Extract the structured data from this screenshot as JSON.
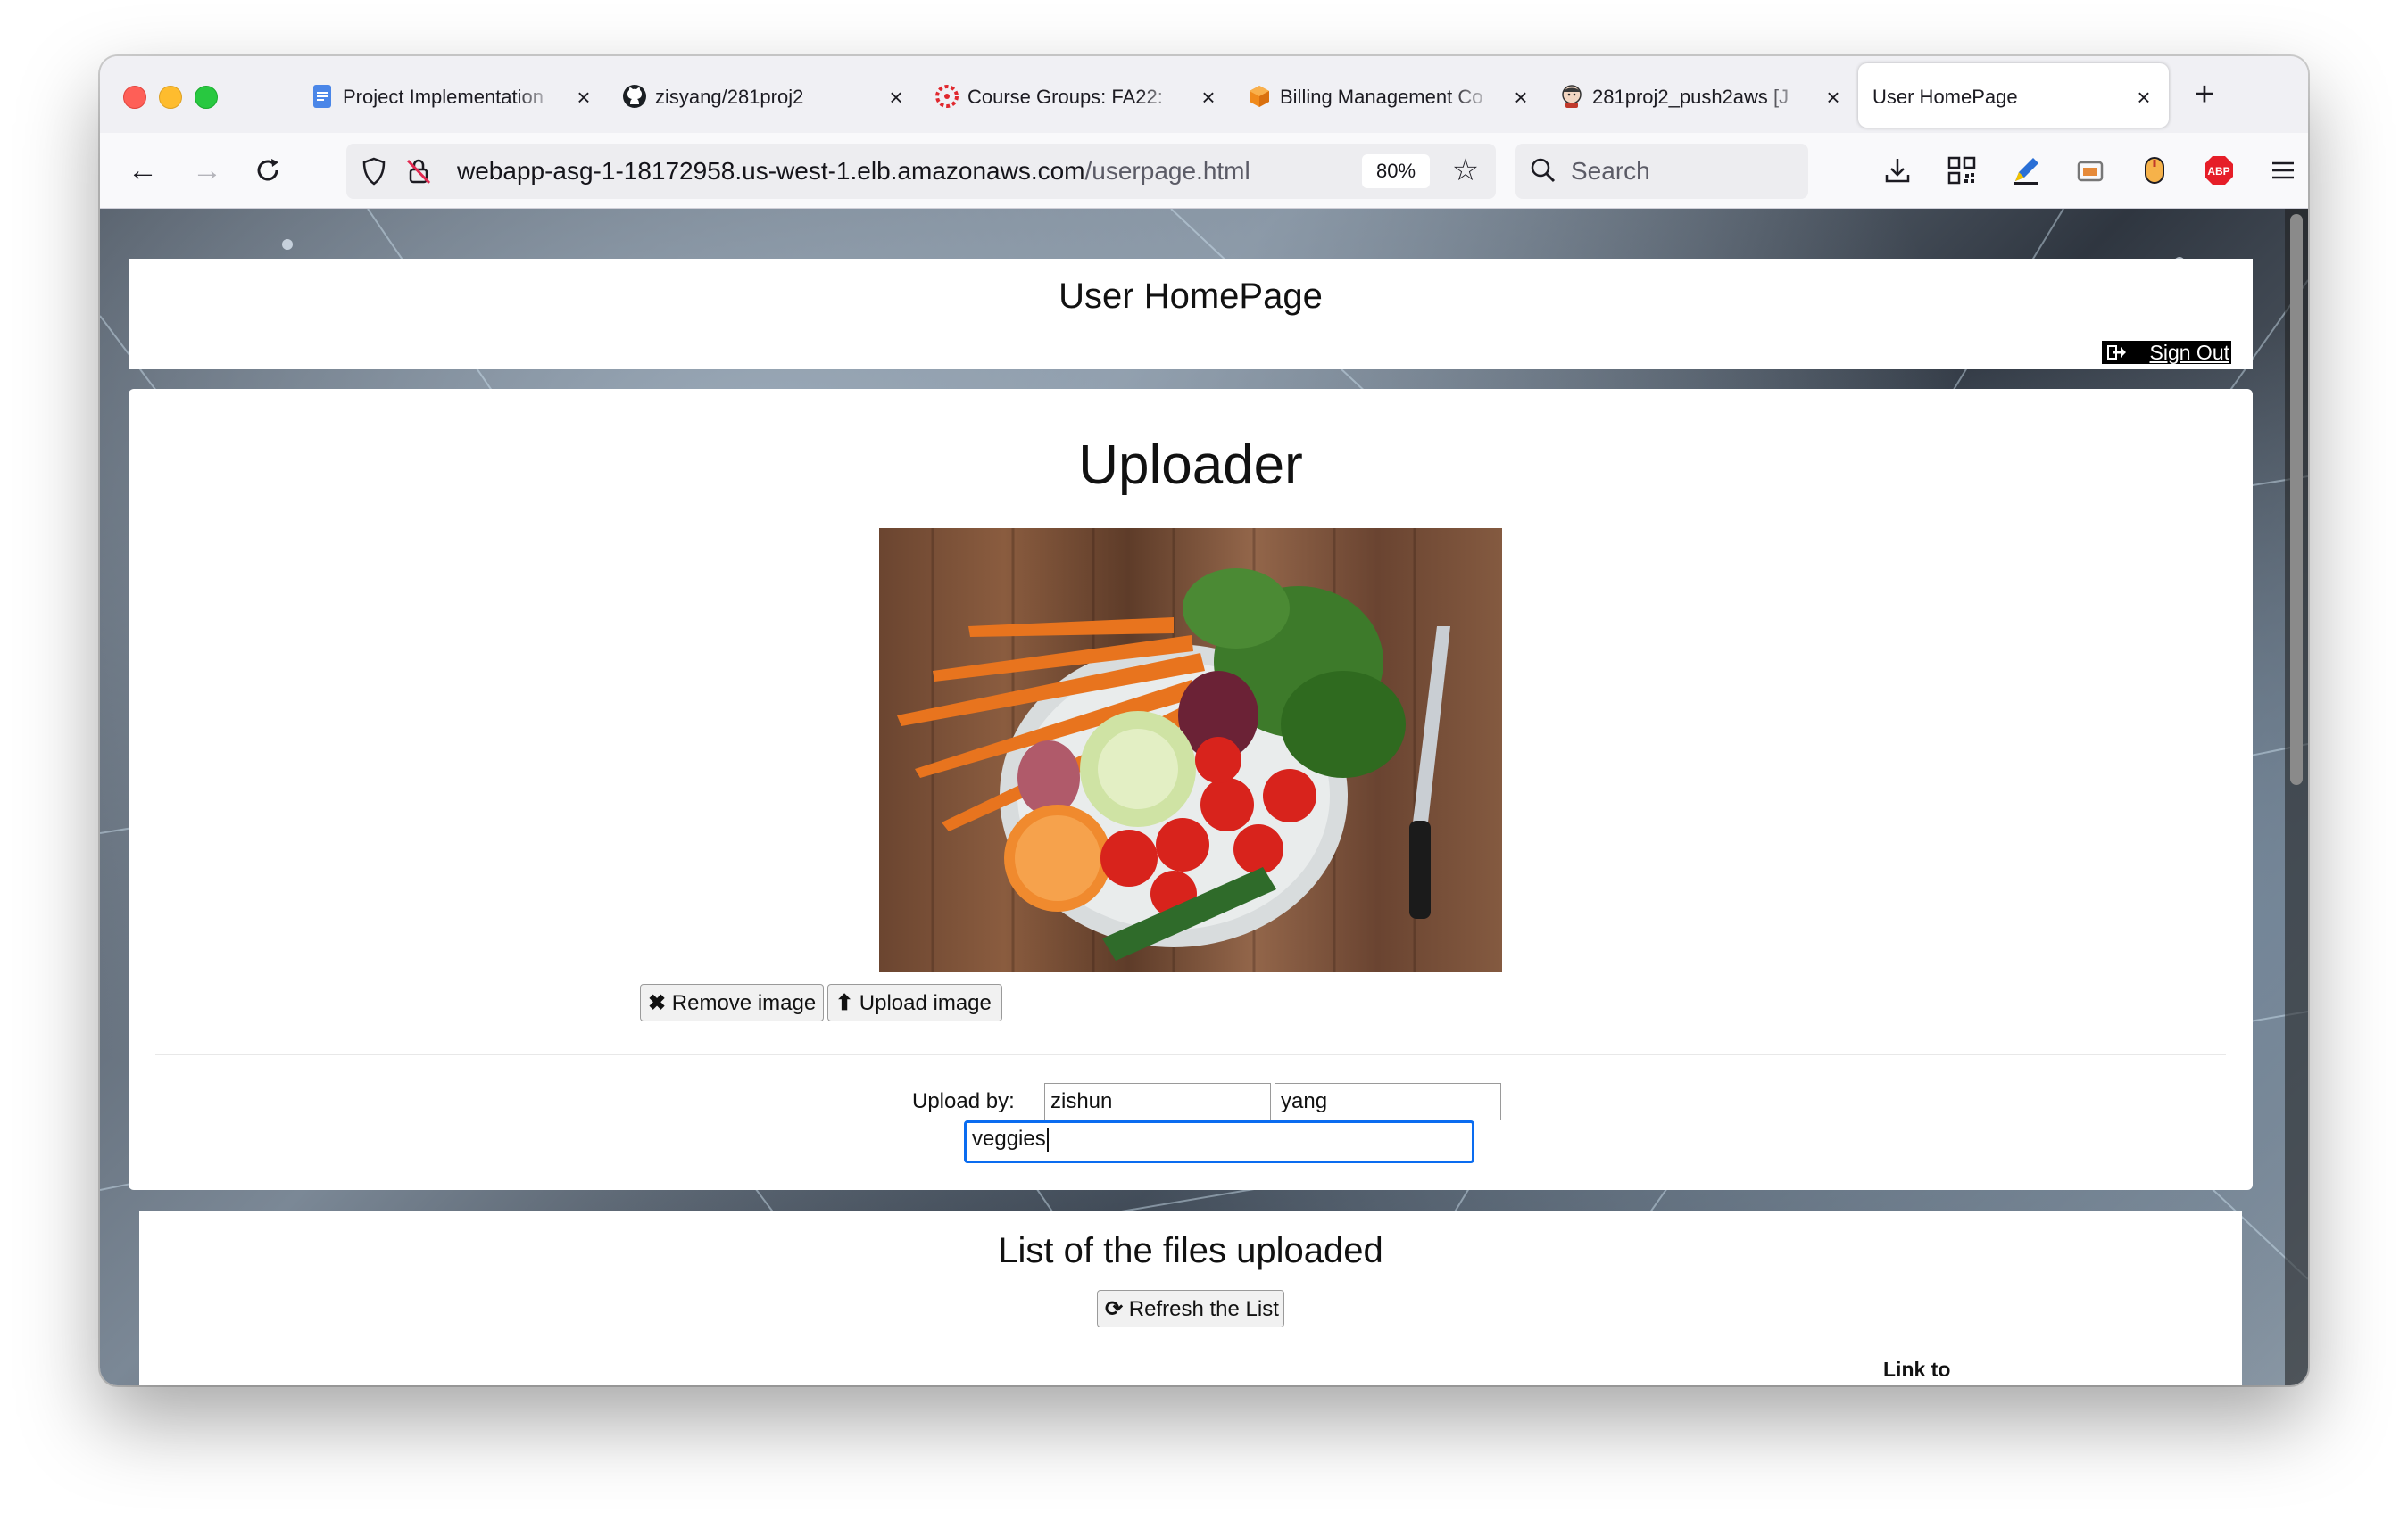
{
  "browser": {
    "tabs": [
      {
        "title": "Project Implementation",
        "icon": "google-docs-icon",
        "active": false
      },
      {
        "title": "zisyang/281proj2",
        "icon": "github-icon",
        "active": false
      },
      {
        "title": "Course Groups: FA22:",
        "icon": "course-groups-icon",
        "active": false
      },
      {
        "title": "Billing Management Co",
        "icon": "aws-billing-icon",
        "active": false
      },
      {
        "title": "281proj2_push2aws [J",
        "icon": "jenkins-icon",
        "active": false
      },
      {
        "title": "User HomePage",
        "icon": "",
        "active": true
      }
    ],
    "url_host": "webapp-asg-1-18172958.us-west-1.elb.amazonaws.com",
    "url_path": "/userpage.html",
    "zoom": "80%",
    "search_placeholder": "Search",
    "colors": {
      "abp_red": "#e61e28",
      "focus_blue": "#0a6cf0"
    }
  },
  "page": {
    "header_title": "User HomePage",
    "sign_out_label": "Sign Out",
    "uploader_title": "Uploader",
    "image_alt": "vegetables",
    "remove_label": "Remove image",
    "upload_label": "Upload image",
    "upload_by_label": "Upload by:",
    "first_name": "zishun",
    "last_name": "yang",
    "description": "veggies",
    "list_title": "List of the files uploaded",
    "refresh_label": "Refresh the List",
    "partial_column_header": "Link to"
  }
}
